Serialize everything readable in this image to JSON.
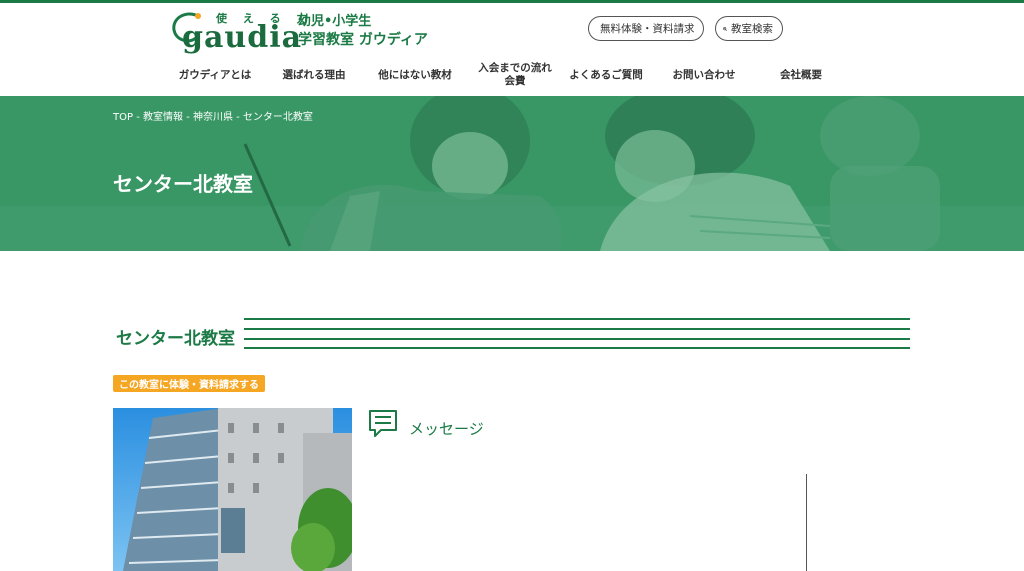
{
  "header": {
    "logo": {
      "tagline": "使 え る 力",
      "wordmark": "gaudia",
      "line1": "幼児•小学生",
      "line2": "学習教室 ガウディア"
    },
    "buttons": {
      "trial": "無料体験・資料請求",
      "search": "教室検索"
    },
    "nav": [
      {
        "label": "ガウディアとは"
      },
      {
        "label": "選ばれる理由"
      },
      {
        "label": "他にはない教材"
      },
      {
        "label": "入会までの流れ\n会費"
      },
      {
        "label": "よくあるご質問"
      },
      {
        "label": "お問い合わせ"
      },
      {
        "label": "会社概要"
      }
    ]
  },
  "hero": {
    "breadcrumb": "TOP - 教室情報 - 神奈川県 - センター北教室",
    "title": "センター北教室"
  },
  "section": {
    "title": "センター北教室",
    "badge": "この教室に体験・資料請求する",
    "message_label": "メッセージ"
  },
  "colors": {
    "brand_green": "#1b7a45",
    "hero_green": "#3a9a68",
    "badge_orange": "#f5a623"
  }
}
